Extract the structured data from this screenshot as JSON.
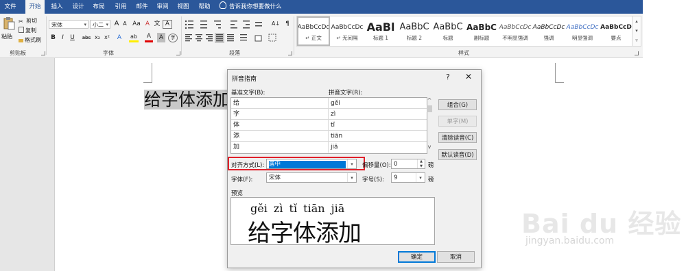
{
  "tabs": [
    "文件",
    "开始",
    "插入",
    "设计",
    "布局",
    "引用",
    "邮件",
    "审阅",
    "视图",
    "帮助"
  ],
  "active_tab": "开始",
  "tell_me": "告诉我你想要做什么",
  "clipboard": {
    "paste": "粘贴",
    "cut": "剪切",
    "copy": "复制",
    "format_painter": "格式刷",
    "group": "剪贴板"
  },
  "font": {
    "name": "宋体",
    "size": "小二",
    "grow": "A",
    "shrink": "A",
    "case": "Aa",
    "clear": "A",
    "wen": "文",
    "box": "A",
    "bold": "B",
    "italic": "I",
    "underline": "U",
    "strike": "abc",
    "sub": "x₂",
    "sup": "x²",
    "effects": "A",
    "highlight": "ab",
    "color": "A",
    "shade": "A",
    "circle": "字",
    "group": "字体"
  },
  "paragraph": {
    "group": "段落",
    "sort": "A↓",
    "marks": "¶"
  },
  "styles": {
    "group": "样式",
    "items": [
      {
        "preview": "AaBbCcDc",
        "name": "↵ 正文"
      },
      {
        "preview": "AaBbCcDc",
        "name": "↵ 无间隔"
      },
      {
        "preview": "AaBl",
        "name": "标题 1"
      },
      {
        "preview": "AaBbC",
        "name": "标题 2"
      },
      {
        "preview": "AaBbC",
        "name": "标题"
      },
      {
        "preview": "AaBbC",
        "name": "副标题"
      },
      {
        "preview": "AaBbCcDc",
        "name": "不明显强调"
      },
      {
        "preview": "AaBbCcDc",
        "name": "强调"
      },
      {
        "preview": "AaBbCcDc",
        "name": "明显强调"
      },
      {
        "preview": "AaBbCcD",
        "name": "要点"
      }
    ]
  },
  "document": {
    "selected_text": "给字体添加"
  },
  "dialog": {
    "title": "拼音指南",
    "help": "?",
    "close": "✕",
    "base_label": "基准文字(B):",
    "ruby_label": "拼音文字(R):",
    "rows": [
      {
        "base": "给",
        "ruby": "gěi"
      },
      {
        "base": "字",
        "ruby": "zì"
      },
      {
        "base": "体",
        "ruby": "tǐ"
      },
      {
        "base": "添",
        "ruby": "tiān"
      },
      {
        "base": "加",
        "ruby": "jiā"
      }
    ],
    "group_btn": "组合(G)",
    "mono_btn": "单字(M)",
    "clear_btn": "清除读音(C)",
    "default_btn": "默认读音(D)",
    "align_label": "对齐方式(L):",
    "align_value": "居中",
    "offset_label": "偏移量(O):",
    "offset_value": "0",
    "offset_unit": "磅",
    "font_label": "字体(F):",
    "font_value": "宋体",
    "size_label": "字号(S):",
    "size_value": "9",
    "size_unit": "磅",
    "preview_label": "预览",
    "preview_pinyin": "gěi zì tǐ tiān jiā",
    "preview_text": "给字体添加",
    "ok": "确定",
    "cancel": "取消"
  },
  "watermark": {
    "main": "Bai du 经验",
    "sub": "jingyan.baidu.com"
  },
  "colors": {
    "ribbon_blue": "#2b579a",
    "highlight_red": "#e0202a",
    "selection_blue": "#0078d7"
  }
}
